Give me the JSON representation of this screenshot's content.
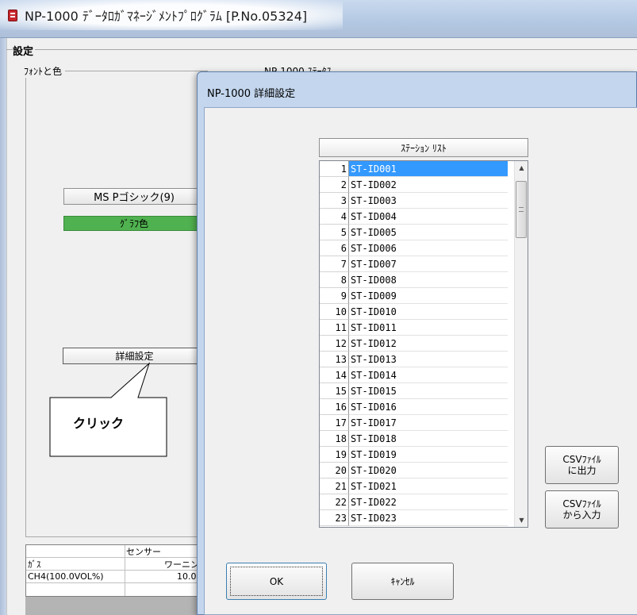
{
  "main_window": {
    "title": "NP-1000 ﾃﾞｰﾀﾛｶﾞﾏﾈｰｼﾞﾒﾝﾄﾌﾟﾛｸﾞﾗﾑ [P.No.05324]",
    "settings_label": "設定",
    "font_group_label": "ﾌｫﾝﾄと色",
    "status_group_label": "NP-1000 ｽﾃｰﾀｽ",
    "font_button_label": "MS Pゴシック(9)",
    "graph_color_label": "ｸﾞﾗﾌ色",
    "detail_settings_label": "詳細設定",
    "callout_text": "クリック",
    "sensor_table": {
      "header_sensor": "センサー",
      "col_gas": "ｶﾞｽ",
      "col_warning": "ワーニン",
      "row_gas": "CH4(100.0VOL%)",
      "row_warning": "10.0"
    }
  },
  "dialog": {
    "title": "NP-1000 詳細設定",
    "list_header": "ｽﾃｰｼｮﾝ ﾘｽﾄ",
    "stations": [
      {
        "no": "1",
        "id": "ST-ID001"
      },
      {
        "no": "2",
        "id": "ST-ID002"
      },
      {
        "no": "3",
        "id": "ST-ID003"
      },
      {
        "no": "4",
        "id": "ST-ID004"
      },
      {
        "no": "5",
        "id": "ST-ID005"
      },
      {
        "no": "6",
        "id": "ST-ID006"
      },
      {
        "no": "7",
        "id": "ST-ID007"
      },
      {
        "no": "8",
        "id": "ST-ID008"
      },
      {
        "no": "9",
        "id": "ST-ID009"
      },
      {
        "no": "10",
        "id": "ST-ID010"
      },
      {
        "no": "11",
        "id": "ST-ID011"
      },
      {
        "no": "12",
        "id": "ST-ID012"
      },
      {
        "no": "13",
        "id": "ST-ID013"
      },
      {
        "no": "14",
        "id": "ST-ID014"
      },
      {
        "no": "15",
        "id": "ST-ID015"
      },
      {
        "no": "16",
        "id": "ST-ID016"
      },
      {
        "no": "17",
        "id": "ST-ID017"
      },
      {
        "no": "18",
        "id": "ST-ID018"
      },
      {
        "no": "19",
        "id": "ST-ID019"
      },
      {
        "no": "20",
        "id": "ST-ID020"
      },
      {
        "no": "21",
        "id": "ST-ID021"
      },
      {
        "no": "22",
        "id": "ST-ID022"
      },
      {
        "no": "23",
        "id": "ST-ID023"
      }
    ],
    "selected_station": "ST-ID001",
    "csv_export_label": "CSVﾌｧｲﾙ\nに出力",
    "csv_import_label": "CSVﾌｧｲﾙ\nから入力",
    "ok_label": "OK",
    "cancel_label": "ｷｬﾝｾﾙ"
  },
  "colors": {
    "graph_color": "#4fb14f",
    "selection": "#3399ff",
    "titlebar": "#b9cce6"
  },
  "icons": {
    "app": "app-icon",
    "scroll_up": "scroll-up-arrow-icon",
    "scroll_down": "scroll-down-arrow-icon"
  }
}
